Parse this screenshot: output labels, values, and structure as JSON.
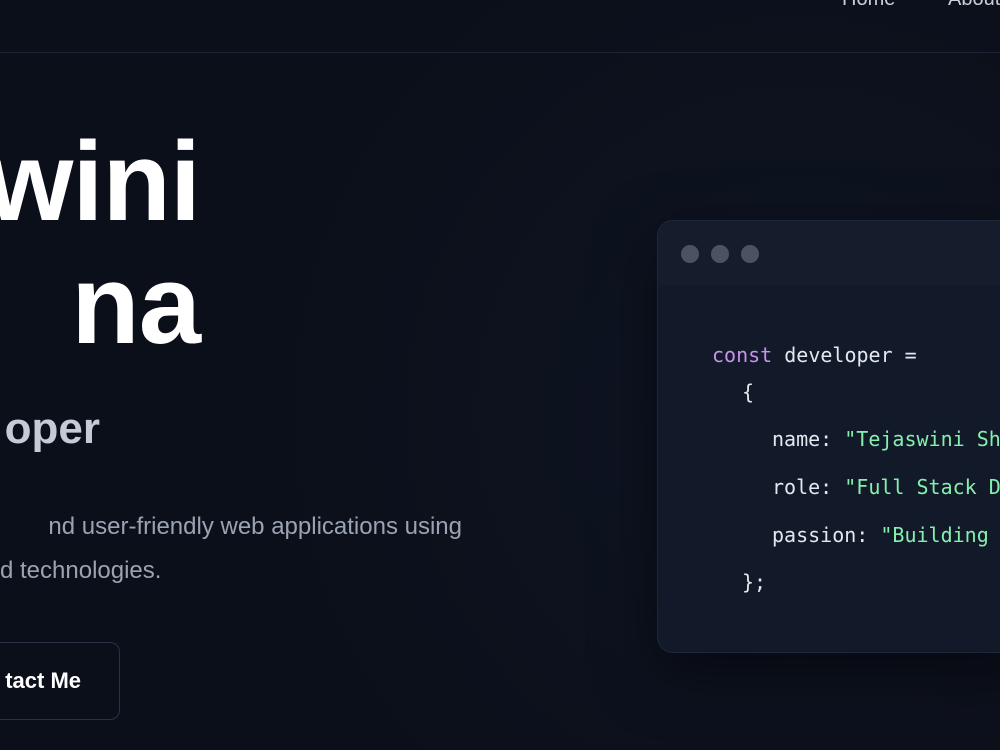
{
  "nav": {
    "home": "Home",
    "about": "About"
  },
  "hero": {
    "name_line1": "wini",
    "name_line2": "na",
    "role": "oper",
    "desc_line1": "nd user-friendly web applications using",
    "desc_line2": "d technologies.",
    "contact_label": "tact Me"
  },
  "code": {
    "kw_const": "const",
    "decl": " developer =",
    "open_brace": "{",
    "name_key": "name: ",
    "name_val": "\"Tejaswini Sh",
    "role_key": "role: ",
    "role_val": "\"Full Stack D",
    "passion_key": "passion: ",
    "passion_val": "\"Building",
    "close_brace": "};"
  },
  "colors": {
    "background": "#0b0f19",
    "keyword": "#c792ea",
    "string": "#86efac",
    "window": "#121a2a"
  }
}
